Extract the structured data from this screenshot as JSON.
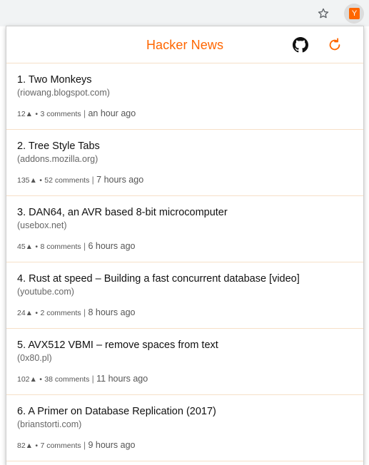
{
  "browser": {
    "bookmark_icon": "star-icon",
    "extension_icon_letter": "Y",
    "extension_color": "#ff6600"
  },
  "popup": {
    "title": "Hacker News",
    "title_color": "#ff6600",
    "github_icon": "github-icon",
    "refresh_icon": "refresh-icon"
  },
  "stories": [
    {
      "title": "1. Two Monkeys",
      "domain": "(riowang.blogspot.com)",
      "points": "12▲",
      "dot": "•",
      "comments": "3 comments",
      "sep": "|",
      "time": "an hour ago"
    },
    {
      "title": "2. Tree Style Tabs",
      "domain": "(addons.mozilla.org)",
      "points": "135▲",
      "dot": "•",
      "comments": "52 comments",
      "sep": "|",
      "time": "7 hours ago"
    },
    {
      "title": "3. DAN64, an AVR based 8-bit microcomputer",
      "domain": "(usebox.net)",
      "points": "45▲",
      "dot": "•",
      "comments": "8 comments",
      "sep": "|",
      "time": "6 hours ago"
    },
    {
      "title": "4. Rust at speed – Building a fast concurrent database [video]",
      "domain": "(youtube.com)",
      "points": "24▲",
      "dot": "•",
      "comments": "2 comments",
      "sep": "|",
      "time": "8 hours ago"
    },
    {
      "title": "5. AVX512 VBMI – remove spaces from text",
      "domain": "(0x80.pl)",
      "points": "102▲",
      "dot": "•",
      "comments": "38 comments",
      "sep": "|",
      "time": "11 hours ago"
    },
    {
      "title": "6. A Primer on Database Replication (2017)",
      "domain": "(brianstorti.com)",
      "points": "82▲",
      "dot": "•",
      "comments": "7 comments",
      "sep": "|",
      "time": "9 hours ago"
    }
  ]
}
